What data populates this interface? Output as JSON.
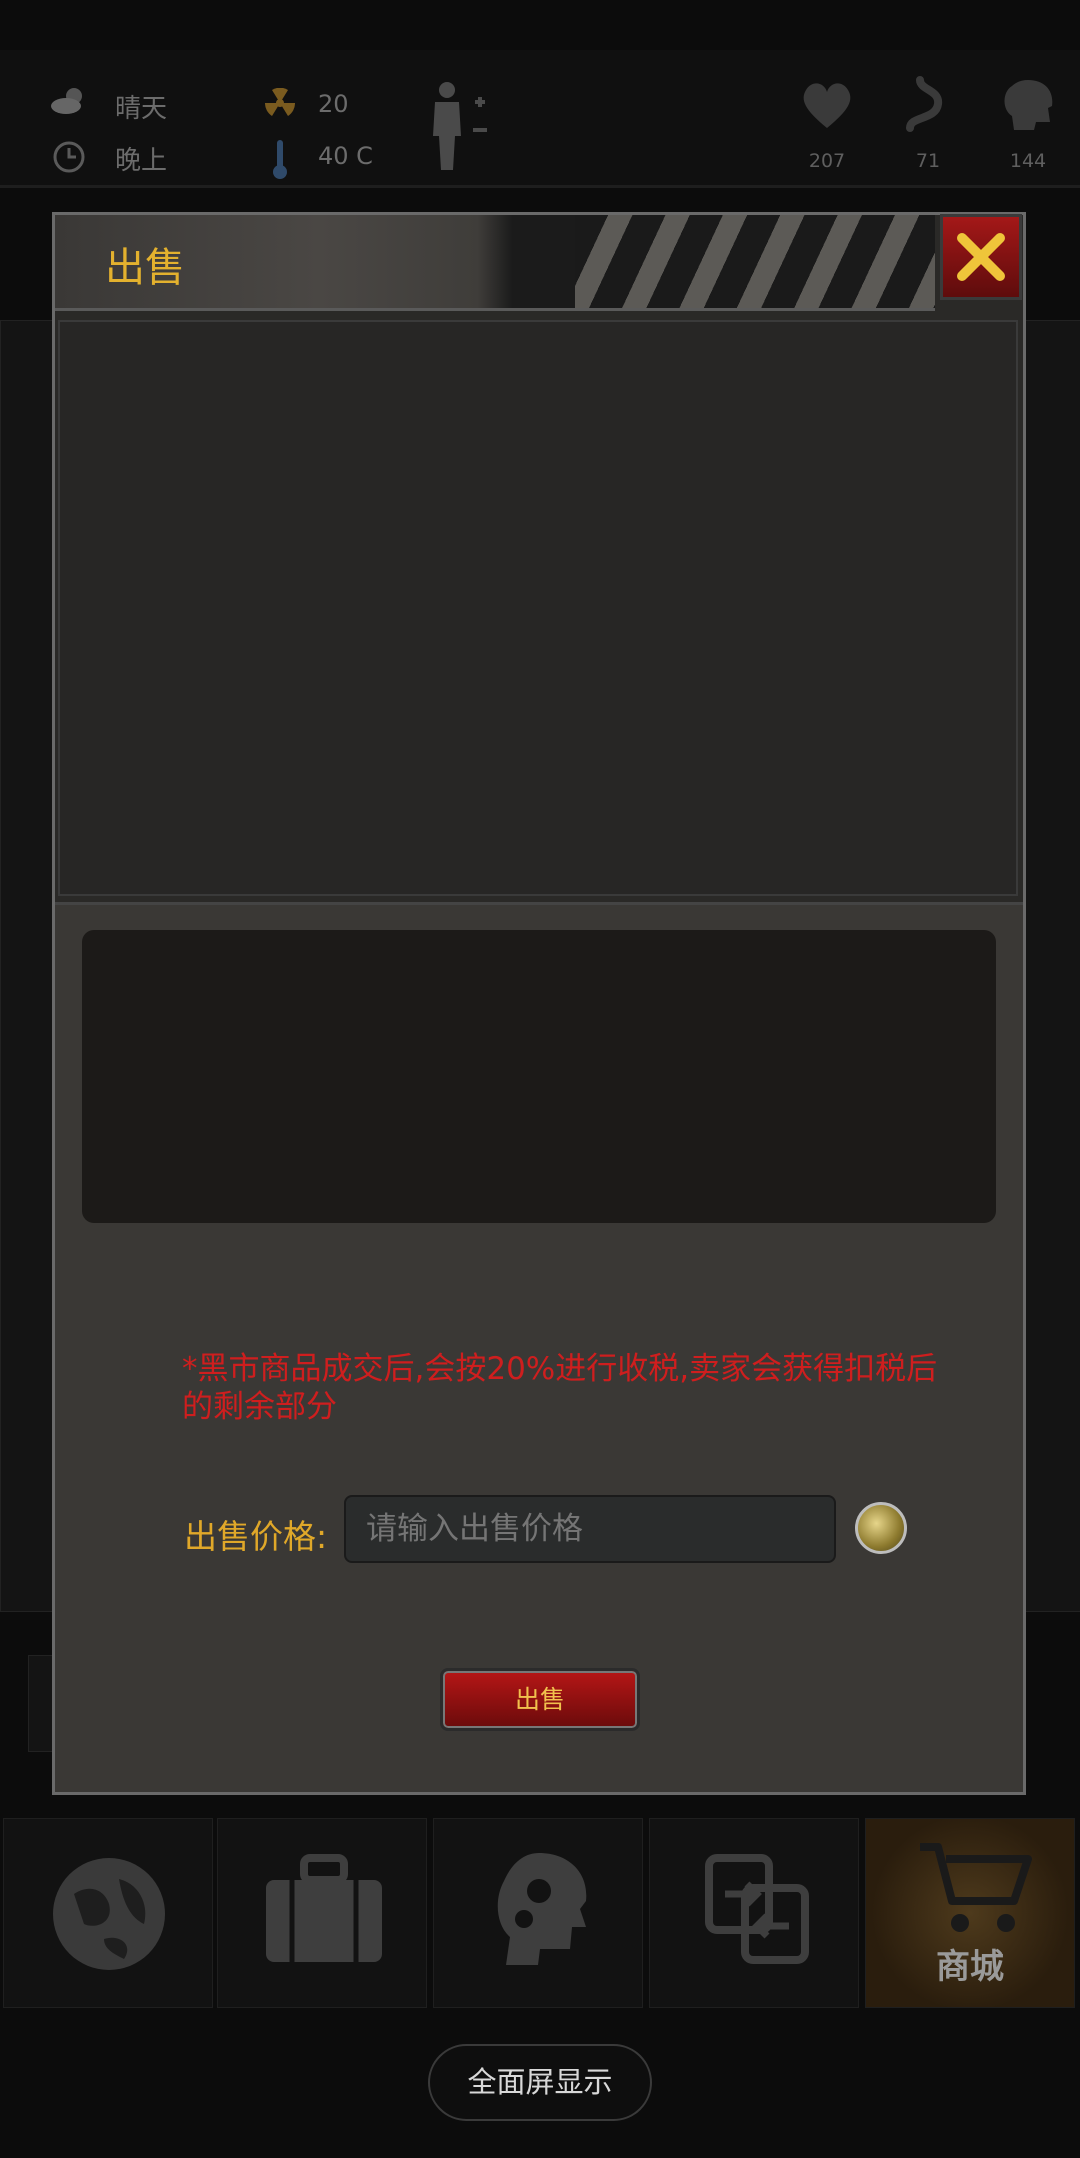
{
  "status": {
    "weather": "晴天",
    "time_of_day": "晚上",
    "radiation": "20",
    "temperature": "40 C",
    "health": "207",
    "hunger": "71",
    "mind": "144"
  },
  "dialog": {
    "title": "出售",
    "close_icon": "close-x-icon",
    "notice": "*黑市商品成交后,会按20%进行收税,卖家会获得扣税后的剩余部分",
    "price_label": "出售价格:",
    "price_placeholder": "请输入出售价格",
    "currency_icon": "bottle-cap-coin-icon",
    "sell_button": "出售"
  },
  "nav": {
    "items": [
      {
        "icon": "world-map-icon",
        "label": ""
      },
      {
        "icon": "suitcase-icon",
        "label": ""
      },
      {
        "icon": "head-gears-icon",
        "label": ""
      },
      {
        "icon": "trade-swap-icon",
        "label": ""
      },
      {
        "icon": "shopping-cart-icon",
        "label": "商城"
      }
    ],
    "active_index": 4
  },
  "fullscreen_button": "全面屏显示",
  "colors": {
    "accent_gold": "#e3b12e",
    "notice_red": "#cf1e1e",
    "button_red": "#b61616"
  }
}
